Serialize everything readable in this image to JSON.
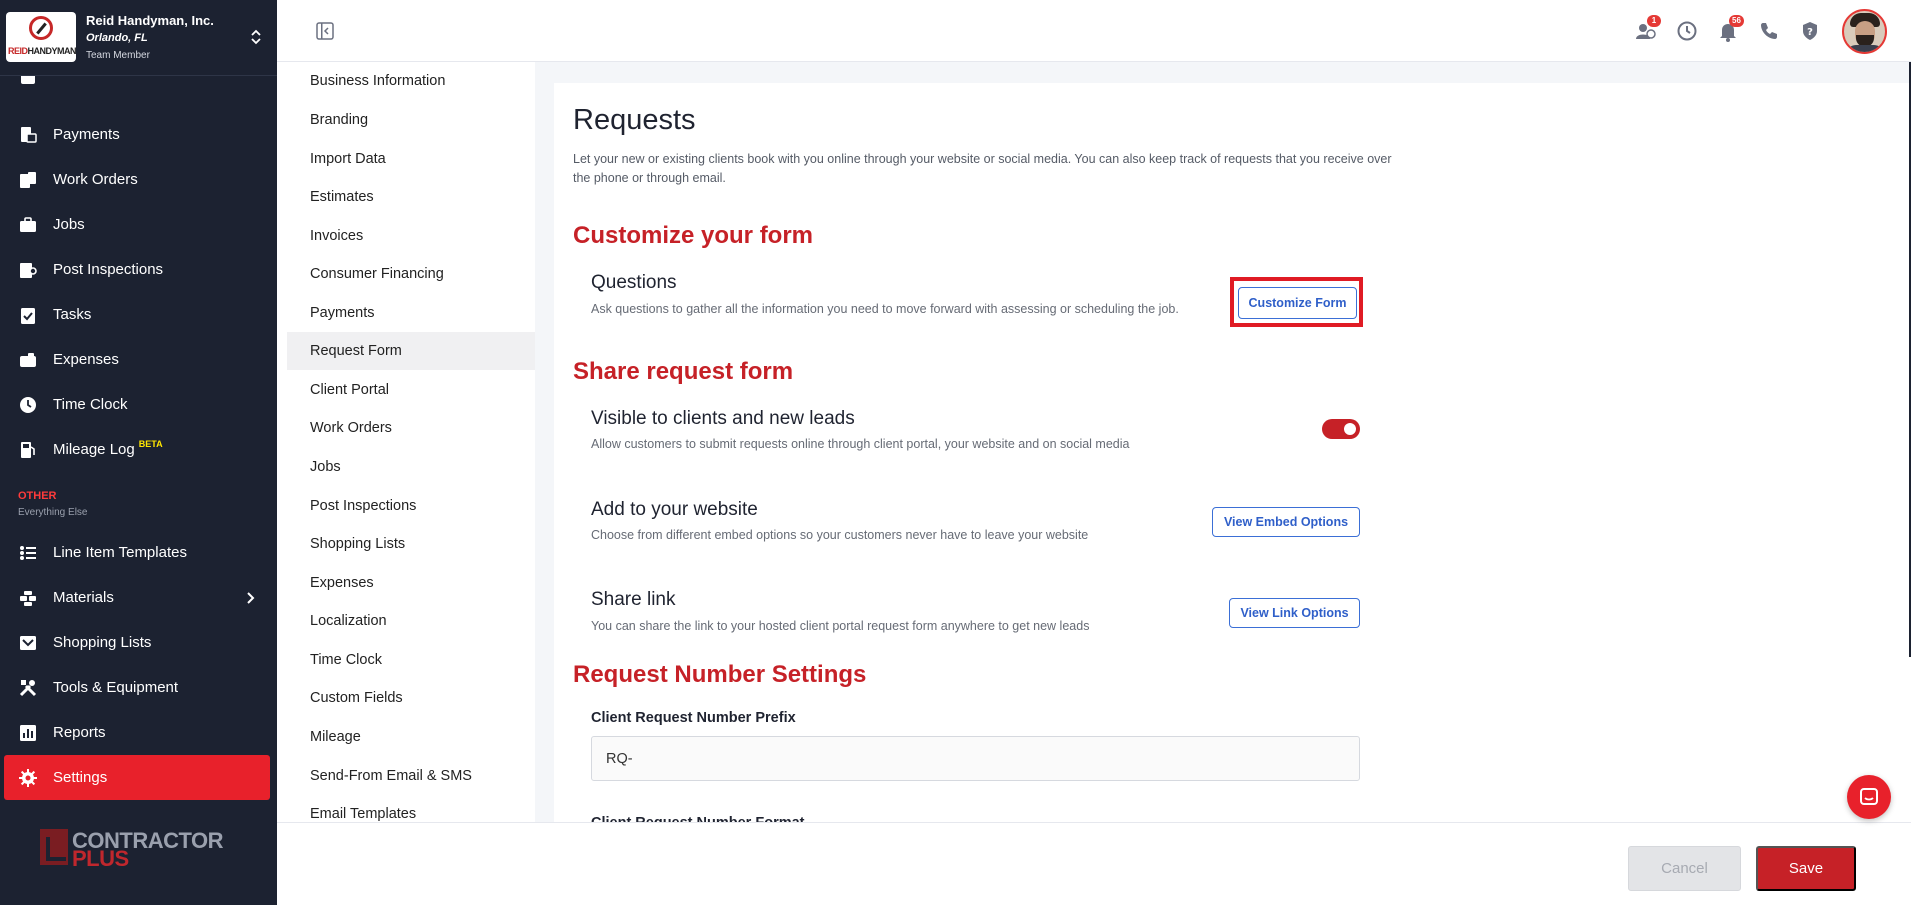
{
  "company": {
    "name": "Reid Handyman, Inc.",
    "location": "Orlando, FL",
    "role": "Team Member",
    "logo_text_red": "REID",
    "logo_text_dark": "HANDYMAN"
  },
  "sidebar": {
    "items": [
      {
        "label": "Payments",
        "icon": "payments-icon"
      },
      {
        "label": "Work Orders",
        "icon": "work-orders-icon"
      },
      {
        "label": "Jobs",
        "icon": "briefcase-icon"
      },
      {
        "label": "Post Inspections",
        "icon": "inspection-icon"
      },
      {
        "label": "Tasks",
        "icon": "clipboard-check-icon"
      },
      {
        "label": "Expenses",
        "icon": "wallet-icon"
      },
      {
        "label": "Time Clock",
        "icon": "clock-icon"
      },
      {
        "label": "Mileage Log",
        "icon": "fuel-icon",
        "badge": "BETA"
      }
    ],
    "other_label": "OTHER",
    "other_sub": "Everything Else",
    "other_items": [
      {
        "label": "Line Item Templates",
        "icon": "list-icon"
      },
      {
        "label": "Materials",
        "icon": "materials-icon"
      },
      {
        "label": "Shopping Lists",
        "icon": "cart-icon"
      },
      {
        "label": "Tools & Equipment",
        "icon": "tools-icon"
      },
      {
        "label": "Reports",
        "icon": "chart-icon"
      },
      {
        "label": "Settings",
        "icon": "gear-icon"
      }
    ],
    "brand_top": "CONTRACTOR",
    "brand_bottom": "PLUS"
  },
  "topbar": {
    "team_badge": "1",
    "notifications_badge": "56"
  },
  "submenu": {
    "items": [
      "Business Information",
      "Branding",
      "Import Data",
      "Estimates",
      "Invoices",
      "Consumer Financing",
      "Payments",
      "Request Form",
      "Client Portal",
      "Work Orders",
      "Jobs",
      "Post Inspections",
      "Shopping Lists",
      "Expenses",
      "Localization",
      "Time Clock",
      "Custom Fields",
      "Mileage",
      "Send-From Email & SMS",
      "Email Templates"
    ],
    "active": "Request Form"
  },
  "main": {
    "title": "Requests",
    "description": "Let your new or existing clients book with you online through your website or social media. You can also keep track of requests that you receive over the phone or through email.",
    "customize_section": "Customize your form",
    "questions_title": "Questions",
    "questions_desc": "Ask questions to gather all the information you need to move forward with assessing or scheduling the job.",
    "customize_button": "Customize Form",
    "share_section": "Share request form",
    "visible_title": "Visible to clients and new leads",
    "visible_desc": "Allow customers to submit requests online through client portal, your website and on social media",
    "visible_on": true,
    "website_title": "Add to your website",
    "website_desc": "Choose from different embed options so your customers never have to leave your website",
    "embed_button": "View Embed Options",
    "share_title": "Share link",
    "share_desc": "You can share the link to your hosted client portal request form anywhere to get new leads",
    "link_button": "View Link Options",
    "number_section": "Request Number Settings",
    "prefix_label": "Client Request Number Prefix",
    "prefix_value": "RQ-",
    "format_label": "Client Request Number Format"
  },
  "footer": {
    "cancel": "Cancel",
    "save": "Save"
  },
  "colors": {
    "sidebar_bg": "#1c2231",
    "accent_red": "#c62127",
    "active_red": "#e8212b",
    "link_blue": "#2f5fc9"
  }
}
